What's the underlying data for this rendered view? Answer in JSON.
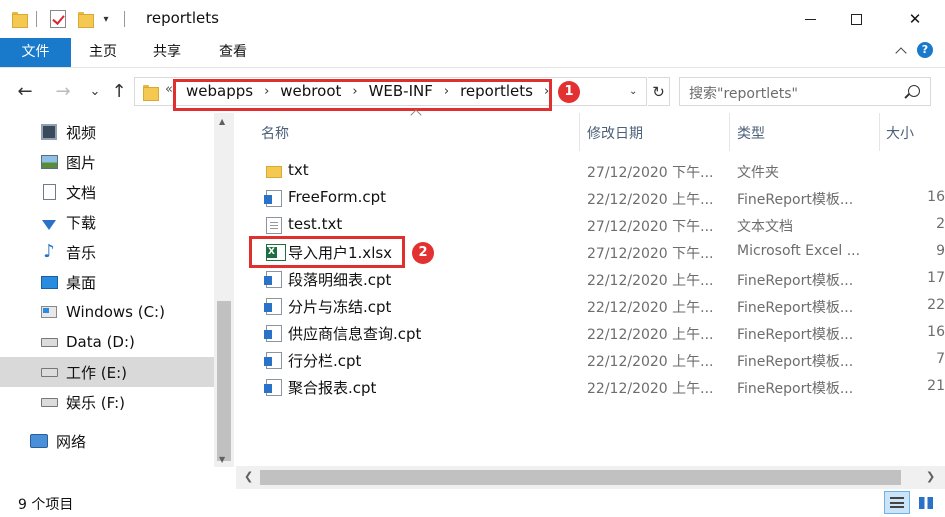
{
  "window": {
    "title": "reportlets",
    "minimize": "—",
    "maximize": "☐",
    "close": "✕"
  },
  "ribbon": {
    "tabs": [
      {
        "label": "文件",
        "active": true
      },
      {
        "label": "主页"
      },
      {
        "label": "共享"
      },
      {
        "label": "查看"
      }
    ],
    "help": "?"
  },
  "address": {
    "back_icon": "←",
    "forward_icon": "→",
    "recent_icon": "⌄",
    "up_icon": "↑",
    "overflow": "«",
    "crumbs": [
      "webapps",
      "webroot",
      "WEB-INF",
      "reportlets"
    ],
    "crumb_separator": "›",
    "dropdown": "⌄",
    "refresh": "↻",
    "badge": "1"
  },
  "search": {
    "placeholder": "搜索\"reportlets\""
  },
  "sidebar": {
    "items": [
      {
        "label": "视频",
        "icon": "video-icon"
      },
      {
        "label": "图片",
        "icon": "pictures-icon"
      },
      {
        "label": "文档",
        "icon": "documents-icon"
      },
      {
        "label": "下载",
        "icon": "downloads-icon"
      },
      {
        "label": "音乐",
        "icon": "music-icon"
      },
      {
        "label": "桌面",
        "icon": "desktop-icon"
      },
      {
        "label": "Windows (C:)",
        "icon": "system-drive-icon"
      },
      {
        "label": "Data (D:)",
        "icon": "drive-icon"
      },
      {
        "label": "工作 (E:)",
        "icon": "drive-icon",
        "selected": true
      },
      {
        "label": "娱乐 (F:)",
        "icon": "drive-icon"
      },
      {
        "label": "网络",
        "icon": "network-icon"
      }
    ]
  },
  "columns": {
    "name": "名称",
    "date": "修改日期",
    "type": "类型",
    "size": "大小"
  },
  "files": [
    {
      "name": "txt",
      "date": "27/12/2020 下午...",
      "type": "文件夹",
      "size": "",
      "icon": "folder-icon"
    },
    {
      "name": "FreeForm.cpt",
      "date": "22/12/2020 上午...",
      "type": "FineReport模板...",
      "size": "16",
      "icon": "cpt-file-icon"
    },
    {
      "name": "test.txt",
      "date": "27/12/2020 下午...",
      "type": "文本文档",
      "size": "2",
      "icon": "text-file-icon"
    },
    {
      "name": "导入用户1.xlsx",
      "date": "27/12/2020 下午...",
      "type": "Microsoft Excel ...",
      "size": "9",
      "icon": "excel-file-icon"
    },
    {
      "name": "段落明细表.cpt",
      "date": "22/12/2020 上午...",
      "type": "FineReport模板...",
      "size": "17",
      "icon": "cpt-file-icon"
    },
    {
      "name": "分片与冻结.cpt",
      "date": "22/12/2020 上午...",
      "type": "FineReport模板...",
      "size": "22",
      "icon": "cpt-file-icon"
    },
    {
      "name": "供应商信息查询.cpt",
      "date": "22/12/2020 上午...",
      "type": "FineReport模板...",
      "size": "16",
      "icon": "cpt-file-icon"
    },
    {
      "name": "行分栏.cpt",
      "date": "22/12/2020 上午...",
      "type": "FineReport模板...",
      "size": "7",
      "icon": "cpt-file-icon"
    },
    {
      "name": "聚合报表.cpt",
      "date": "22/12/2020 上午...",
      "type": "FineReport模板...",
      "size": "21",
      "icon": "cpt-file-icon"
    }
  ],
  "file_badge": "2",
  "status": {
    "count": "9 个项目"
  },
  "colors": {
    "accent": "#1979ca",
    "highlight": "#e02f2f"
  }
}
